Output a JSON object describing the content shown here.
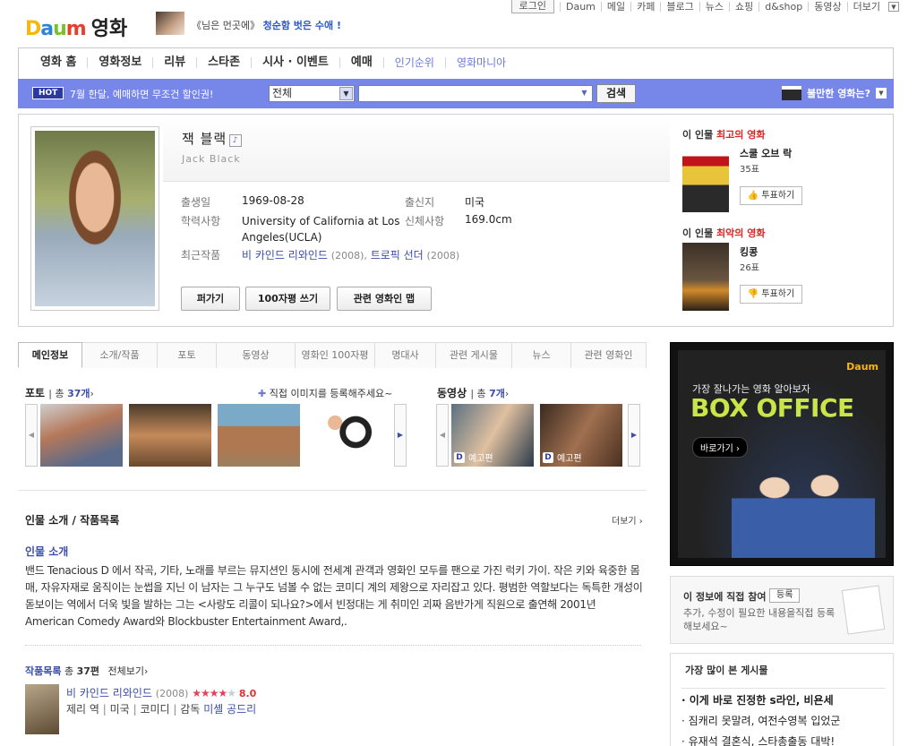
{
  "header": {
    "logo": {
      "d": "D",
      "a": "a",
      "u": "u",
      "m": "m",
      "section": "영화"
    },
    "promo_prefix": "《님은 먼곳에》",
    "promo_highlight": "청순함 벗은 수애 !",
    "top_nav": [
      "로그인",
      "Daum",
      "메일",
      "카페",
      "블로그",
      "뉴스",
      "쇼핑",
      "d&shop",
      "동영상",
      "더보기"
    ]
  },
  "main_nav": [
    "영화 홈",
    "영화정보",
    "리뷰",
    "스타존",
    "시사 · 이벤트",
    "예매"
  ],
  "sub_nav": [
    "인기순위",
    "영화마니아"
  ],
  "search": {
    "hot_badge": "HOT",
    "hot_text": "7월 한달, 예매하면 무조건 할인권!",
    "category": "전체",
    "query": "",
    "button": "검색",
    "complaint": "불만한 영화는?"
  },
  "profile": {
    "name_kr": "잭 블랙",
    "name_en": "Jack Black",
    "labels": {
      "birth": "출생일",
      "birthplace": "출신지",
      "education": "학력사항",
      "height": "신체사항",
      "recent": "최근작품"
    },
    "birth": "1969-08-28",
    "birthplace": "미국",
    "education": "University of California at Los Angeles(UCLA)",
    "height": "169.0cm",
    "recent": [
      {
        "title": "비 카인드 리와인드",
        "year": "(2008),"
      },
      {
        "title": "트로픽 선더",
        "year": "(2008)"
      }
    ],
    "buttons": [
      "퍼가기",
      "100자평 쓰기",
      "관련 영화인 맵"
    ]
  },
  "ranking": {
    "best": {
      "title_prefix": "이 인물 ",
      "title_highlight": "최고의 영화",
      "film": "스쿨 오브 락",
      "votes": "35표",
      "vote_btn": "투표하기"
    },
    "worst": {
      "title_prefix": "이 인물 ",
      "title_highlight": "최악의 영화",
      "film": "킹콩",
      "votes": "26표",
      "vote_btn": "투표하기"
    }
  },
  "tabs": [
    "메인정보",
    "소개/작품",
    "포토",
    "동영상",
    "영화인 100자평",
    "명대사",
    "관련 게시물",
    "뉴스",
    "관련 영화인"
  ],
  "photo": {
    "title": "포토",
    "count_prefix": "총 ",
    "count": "37개",
    "register": "직접 이미지를 등록해주세요~"
  },
  "video": {
    "title": "동영상",
    "count_prefix": "총 ",
    "count": "7개",
    "labels": [
      "예고편",
      "예고편"
    ]
  },
  "bio": {
    "title": "인물 소개 / 작품목록",
    "more": "더보기",
    "subtitle": "인물 소개",
    "text": "밴드 Tenacious D 에서 작곡, 기타, 노래를 부르는 뮤지션인 동시에 전세계 관객과 영화인 모두를 팬으로 가진 럭키 가이. 작은 키와 육중한 몸매, 자유자재로 움직이는 눈썹을 지닌 이 남자는 그 누구도 넘볼 수 없는 코미디 계의 제왕으로 자리잡고 있다. 평범한 역할보다는 독특한 개성이 돋보이는 역에서 더욱 빛을 발하는 그는 <사랑도 리콜이 되나요?>에서 빈정대는 게 취미인 괴짜 음반가게 직원으로 출연해 2001년 American Comedy Award와 Blockbuster Entertainment Award,."
  },
  "films": {
    "title": "작품목록",
    "count_prefix": "총 ",
    "count": "37편",
    "view_all": "전체보기",
    "items": [
      {
        "title": "비 카인드 리와인드",
        "year": "(2008)",
        "rating": "8.0",
        "role": "제리 역",
        "country": "미국",
        "genre": "코미디",
        "director_label": "감독",
        "director": "미셸 공드리"
      }
    ]
  },
  "ad": {
    "logo": "Daum",
    "tagline": "가장 잘나가는 영화 알아보자",
    "title": "BOX OFFICE",
    "button": "바로가기 ›"
  },
  "participate": {
    "title": "이 정보에 직접 참여",
    "button": "등록",
    "desc": "추가, 수정이 필요한 내용을직접 등록해보세요~"
  },
  "popular": {
    "title": "가장 많이 본 게시물",
    "items": [
      "· 이게 바로 진정한 s라인, 비욘세",
      "· 짐캐리 못말려, 여전수영복 입었군",
      "· 유재석 결혼식, 스타총출동 대박!"
    ]
  }
}
